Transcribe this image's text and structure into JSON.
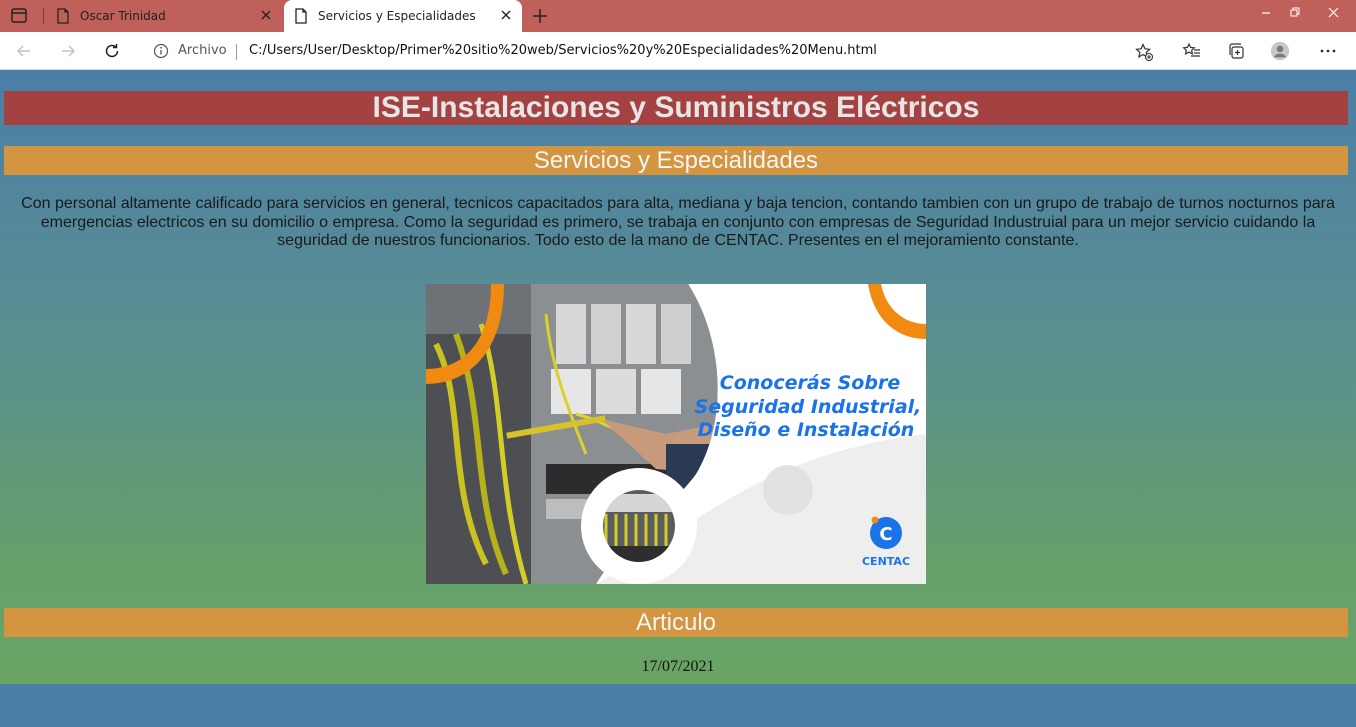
{
  "browser": {
    "tabs": [
      {
        "title": "Oscar Trinidad",
        "active": false
      },
      {
        "title": "Servicios y Especialidades",
        "active": true
      }
    ],
    "address": {
      "security_label": "Archivo",
      "url": "C:/Users/User/Desktop/Primer%20sitio%20web/Servicios%20y%20Especialidades%20Menu.html"
    },
    "colors": {
      "tabbar": "#c0605a",
      "toolbar": "#ffffff"
    }
  },
  "page": {
    "site_title": "ISE-Instalaciones y Suministros Eléctricos",
    "services_heading": "Servicios y Especialidades",
    "description": "Con personal altamente calificado para servicios en general, tecnicos capacitados para alta, mediana y baja tencion, contando tambien con un grupo de trabajo de turnos nocturnos para emergencias electricos en su domicilio o empresa. Como la seguridad es primero, se trabaja en conjunto con empresas de Seguridad Industruial para un mejor servicio cuidando la seguridad de nuestros funcionarios. Todo esto de la mano de CENTAC. Presentes en el mejoramiento constante.",
    "banner": {
      "headline": [
        "Conocerás Sobre",
        "Seguridad Industrial,",
        "Diseño e Instalación"
      ],
      "brand": "CENTAC",
      "brand_letter": "C"
    },
    "article_heading": "Articulo",
    "article_date": "17/07/2021",
    "colors": {
      "title_bar": "#a44242",
      "section_bar": "#d39540",
      "gradient_top": "#4a7fa8",
      "gradient_bottom": "#6aa564",
      "banner_blue": "#1a73e8",
      "banner_orange": "#f08a10"
    }
  }
}
